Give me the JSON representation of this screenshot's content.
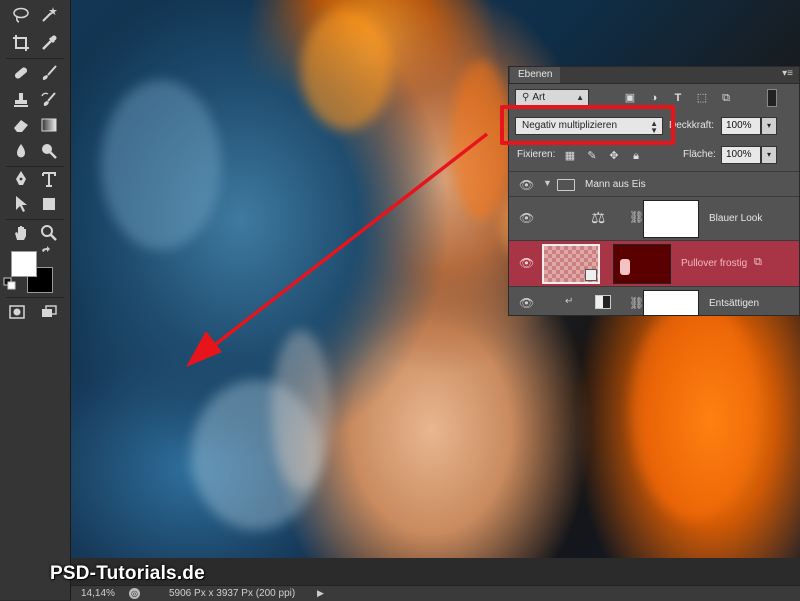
{
  "panel": {
    "tab_label": "Ebenen",
    "menu_icon": "panel-menu-icon",
    "filter_kind": "Art",
    "blend_mode": "Negativ multiplizieren",
    "opacity_label": "Deckkraft:",
    "opacity_value": "100%",
    "lock_label": "Fixieren:",
    "fill_label": "Fläche:",
    "fill_value": "100%",
    "layers": [
      {
        "name": "Mann aus Eis",
        "kind": "group",
        "visible": true
      },
      {
        "name": "Blauer Look",
        "kind": "adjustment-balance",
        "visible": true
      },
      {
        "name": "Pullover frostig",
        "kind": "smart-layer",
        "visible": true,
        "selected": true
      },
      {
        "name": "Entsättigen",
        "kind": "adjustment-hue",
        "visible": true
      }
    ]
  },
  "statusbar": {
    "zoom": "14,14%",
    "doc_info": "5906 Px x 3937 Px (200 ppi)"
  },
  "watermark": "PSD-Tutorials.de",
  "colors": {
    "highlight": "#e8141c",
    "selected_layer": "#a83545",
    "foreground": "#ffffff",
    "background": "#000000"
  }
}
